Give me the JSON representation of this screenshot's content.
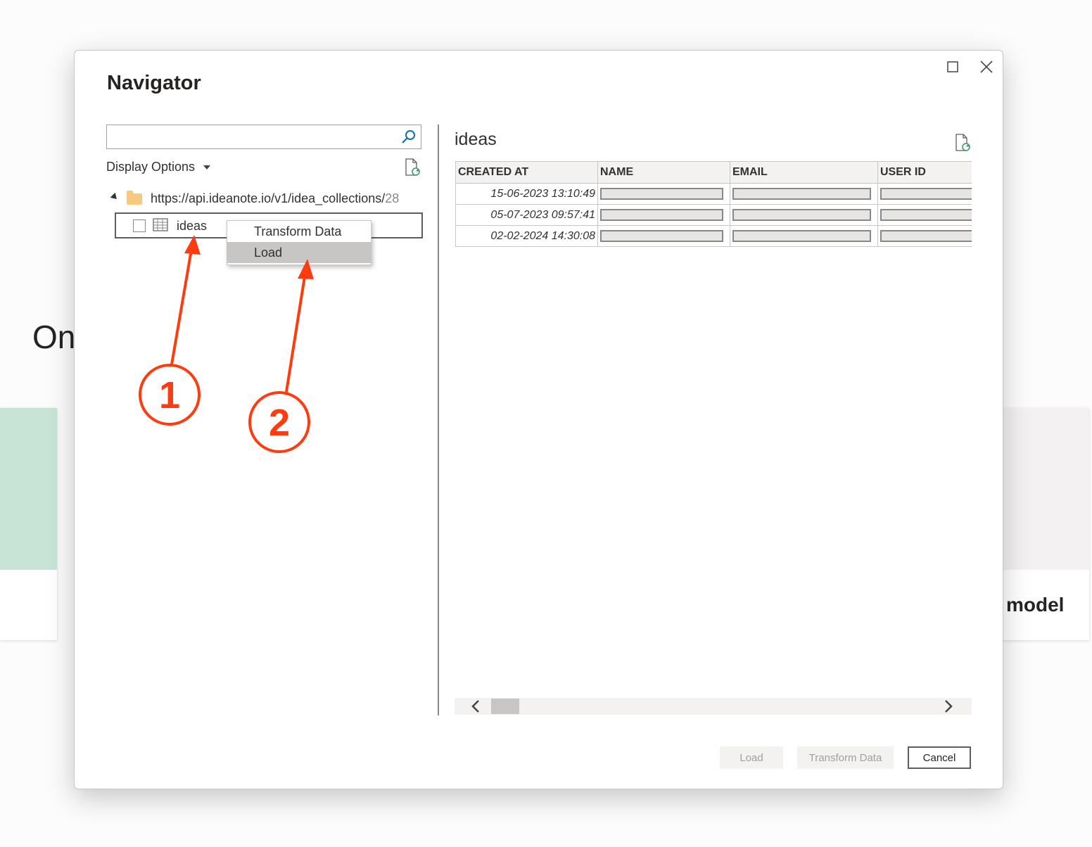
{
  "background": {
    "heading_fragment": "On",
    "right_card_label": "model"
  },
  "dialog": {
    "title": "Navigator",
    "window_controls": {
      "maximize": "maximize-icon",
      "close": "close-icon"
    },
    "search": {
      "value": "",
      "placeholder": ""
    },
    "display_options_label": "Display Options",
    "tree": {
      "root_url": "https://api.ideanote.io/v1/idea_collections/",
      "root_count": "28",
      "item_label": "ideas",
      "item_checked": false
    },
    "context_menu": {
      "items": [
        {
          "label": "Transform Data",
          "highlighted": false
        },
        {
          "label": "Load",
          "highlighted": true
        }
      ]
    },
    "preview": {
      "title": "ideas",
      "columns": [
        "CREATED AT",
        "NAME",
        "EMAIL",
        "USER ID"
      ],
      "rows": [
        {
          "created_at": "15-06-2023 13:10:49"
        },
        {
          "created_at": "05-07-2023 09:57:41"
        },
        {
          "created_at": "02-02-2024 14:30:08"
        }
      ]
    },
    "buttons": {
      "load": "Load",
      "transform": "Transform Data",
      "cancel": "Cancel"
    }
  },
  "annotations": {
    "callout_1": "1",
    "callout_2": "2",
    "color": "#ff3b10"
  }
}
